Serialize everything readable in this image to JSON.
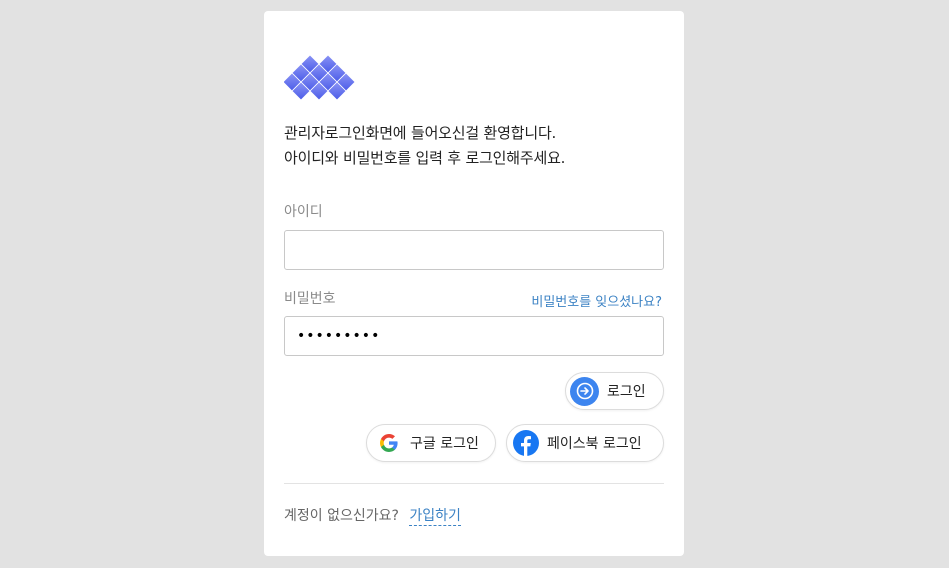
{
  "welcome": {
    "line1": "관리자로그인화면에 들어오신걸 환영합니다.",
    "line2": "아이디와 비밀번호를 입력 후 로그인해주세요."
  },
  "form": {
    "id_label": "아이디",
    "id_value": "",
    "password_label": "비밀번호",
    "password_value": "•••••••••",
    "forgot_password": "비밀번호를 잊으셨나요?"
  },
  "buttons": {
    "login": "로그인",
    "google_login": "구글 로그인",
    "facebook_login": "페이스북 로그인"
  },
  "signup": {
    "prompt": "계정이 없으신가요?",
    "link": "가입하기"
  },
  "icons": {
    "logo": "logo-icon",
    "login": "arrow-right-circle-icon",
    "google": "google-icon",
    "facebook": "facebook-icon"
  },
  "colors": {
    "accent": "#3d85ef",
    "link": "#3b82c4",
    "logo": "#5b6cf0",
    "facebook": "#1877f2",
    "background": "#e2e2e2"
  }
}
